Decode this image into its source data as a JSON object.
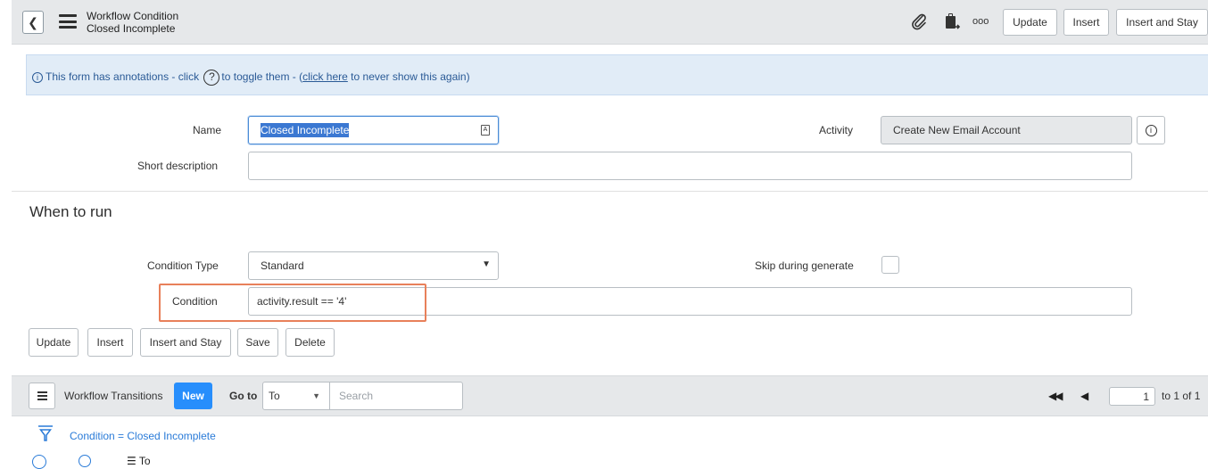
{
  "header": {
    "title": "Workflow Condition",
    "subtitle": "Closed Incomplete",
    "buttons": {
      "update": "Update",
      "insert": "Insert",
      "insert_and_stay": "Insert and Stay"
    },
    "more_label": "ooo"
  },
  "banner": {
    "prefix": "This form has annotations - click",
    "middle": "to toggle them - (",
    "link": "click here",
    "suffix": "to never show this again)"
  },
  "form": {
    "name_label": "Name",
    "name_value": "Closed Incomplete",
    "short_description_label": "Short description",
    "short_description_value": "",
    "activity_label": "Activity",
    "activity_value": "Create New Email Account",
    "section_title": "When to run",
    "condition_type_label": "Condition Type",
    "condition_type_value": "Standard",
    "skip_label": "Skip during generate",
    "condition_label": "Condition",
    "condition_value": "activity.result == '4'"
  },
  "actions": {
    "update": "Update",
    "insert": "Insert",
    "insert_and_stay": "Insert and Stay",
    "save": "Save",
    "delete": "Delete"
  },
  "related_list": {
    "title": "Workflow Transitions",
    "new_label": "New",
    "goto_label": "Go to",
    "goto_field": "To",
    "search_placeholder": "Search",
    "page_number": "1",
    "page_suffix": "to 1 of 1",
    "filter_text": "Condition = Closed Incomplete",
    "partial_column": "To"
  },
  "colors": {
    "accent": "#278efc",
    "highlight": "#e8805a",
    "banner_bg": "#e1ecf7"
  }
}
